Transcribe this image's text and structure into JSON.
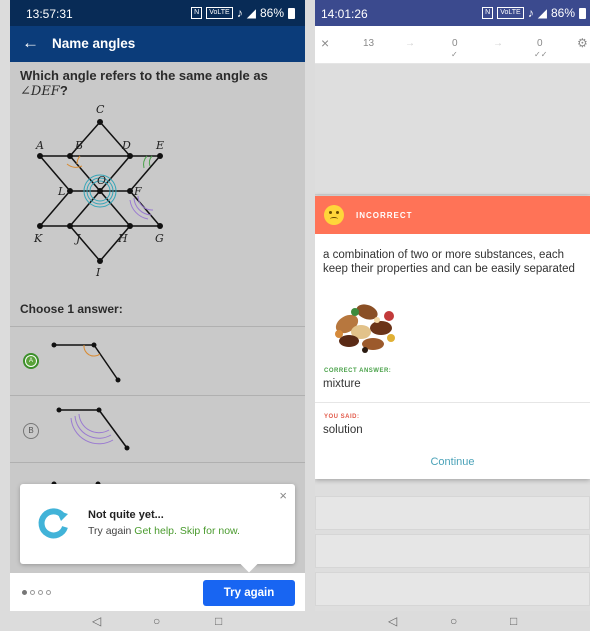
{
  "left": {
    "status": {
      "time": "13:57:31",
      "nfc": "N",
      "volte": "VoLTE",
      "battery": "86%"
    },
    "appbar": {
      "title": "Name angles",
      "back_glyph": "←"
    },
    "question": {
      "prefix": "Which angle refers to the same angle as ",
      "math": "∠DEF",
      "suffix": "?"
    },
    "figure_labels": {
      "A": "A",
      "B": "B",
      "C": "C",
      "D": "D",
      "E": "E",
      "F": "F",
      "G": "G",
      "H": "H",
      "I": "I",
      "J": "J",
      "K": "K",
      "L": "L",
      "O": "O"
    },
    "choose_label": "Choose 1 answer:",
    "options": [
      {
        "letter": "A",
        "selected": true
      },
      {
        "letter": "B",
        "selected": false
      }
    ],
    "toast": {
      "close": "×",
      "heading": "Not quite yet...",
      "body_prefix": "Try again ",
      "link1": "Get help.",
      "link2": "Skip for now."
    },
    "bottom": {
      "try_again": "Try again"
    },
    "nav": {
      "back": "◁",
      "home": "○",
      "recent": "□"
    }
  },
  "right": {
    "status": {
      "time": "14:01:26",
      "nfc": "N",
      "volte": "VoLTE",
      "battery": "86%"
    },
    "topbar": {
      "close": "×",
      "count": "13",
      "arrow1": "→",
      "zero1": "0",
      "arrow2": "→",
      "zero2": "0",
      "settings": "⚙"
    },
    "card": {
      "header": "INCORRECT",
      "definition": "a combination of two or more substances, each keep their properties and can be easily separated",
      "correct_label": "CORRECT ANSWER:",
      "correct_answer": "mixture",
      "you_said_label": "YOU SAID:",
      "you_said": "solution",
      "continue": "Continue"
    },
    "nav": {
      "back": "◁",
      "home": "○",
      "recent": "□"
    }
  },
  "colors": {
    "left_statusbar": "#082b56",
    "appbar": "#0b3c7a",
    "try_again": "#1865f2",
    "right_statusbar": "#3b4a8e",
    "incorrect_header": "#ff7357",
    "correct_label": "#4aa24a",
    "you_said_label": "#e25a4a",
    "continue_text": "#4aa2b8"
  }
}
